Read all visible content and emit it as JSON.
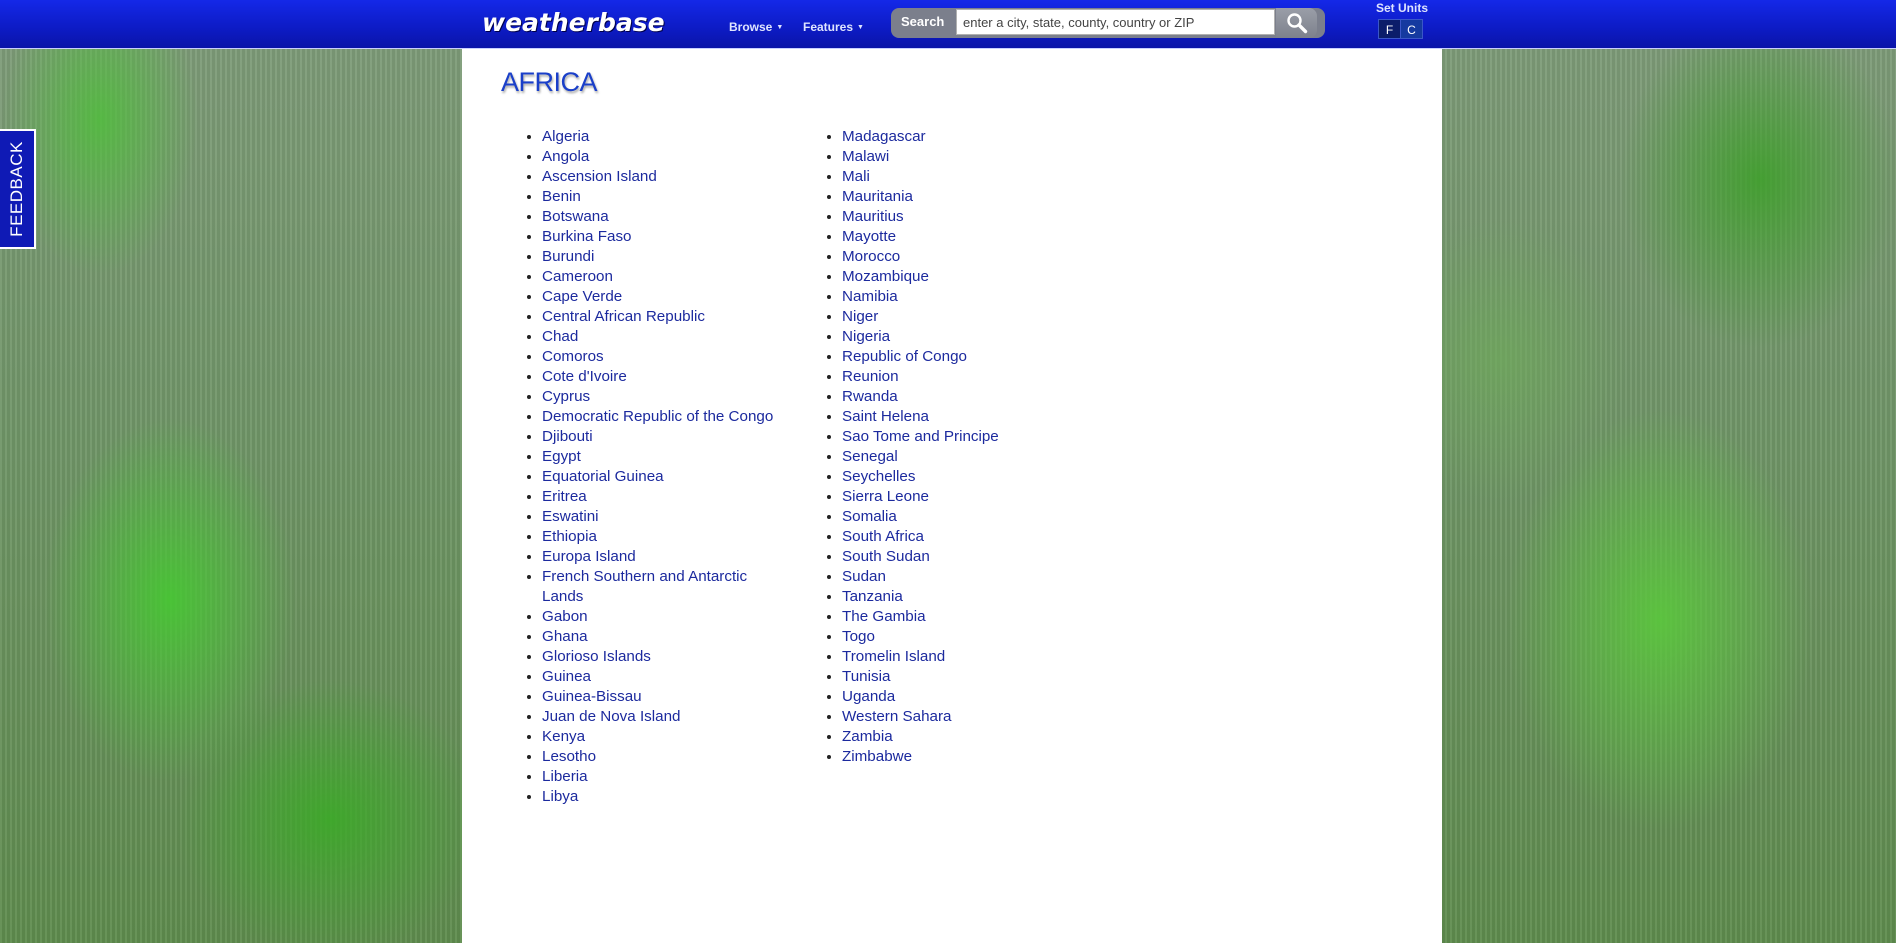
{
  "header": {
    "logo": "weatherbase",
    "nav": [
      {
        "label": "Browse"
      },
      {
        "label": "Features"
      }
    ],
    "search": {
      "label": "Search",
      "placeholder": "enter a city, state, county, country or ZIP",
      "button_icon": "magnifier-icon"
    },
    "units": {
      "label": "Set Units",
      "options": [
        "F",
        "C"
      ]
    }
  },
  "feedback_tab": {
    "label": "FEEDBACK"
  },
  "main": {
    "title": "AFRICA",
    "column1": [
      "Algeria",
      "Angola",
      "Ascension Island",
      "Benin",
      "Botswana",
      "Burkina Faso",
      "Burundi",
      "Cameroon",
      "Cape Verde",
      "Central African Republic",
      "Chad",
      "Comoros",
      "Cote d'Ivoire",
      "Cyprus",
      "Democratic Republic of the Congo",
      "Djibouti",
      "Egypt",
      "Equatorial Guinea",
      "Eritrea",
      "Eswatini",
      "Ethiopia",
      "Europa Island",
      "French Southern and Antarctic Lands",
      "Gabon",
      "Ghana",
      "Glorioso Islands",
      "Guinea",
      "Guinea-Bissau",
      "Juan de Nova Island",
      "Kenya",
      "Lesotho",
      "Liberia",
      "Libya"
    ],
    "column2": [
      "Madagascar",
      "Malawi",
      "Mali",
      "Mauritania",
      "Mauritius",
      "Mayotte",
      "Morocco",
      "Mozambique",
      "Namibia",
      "Niger",
      "Nigeria",
      "Republic of Congo",
      "Reunion",
      "Rwanda",
      "Saint Helena",
      "Sao Tome and Principe",
      "Senegal",
      "Seychelles",
      "Sierra Leone",
      "Somalia",
      "South Africa",
      "South Sudan",
      "Sudan",
      "Tanzania",
      "The Gambia",
      "Togo",
      "Tromelin Island",
      "Tunisia",
      "Uganda",
      "Western Sahara",
      "Zambia",
      "Zimbabwe"
    ]
  }
}
